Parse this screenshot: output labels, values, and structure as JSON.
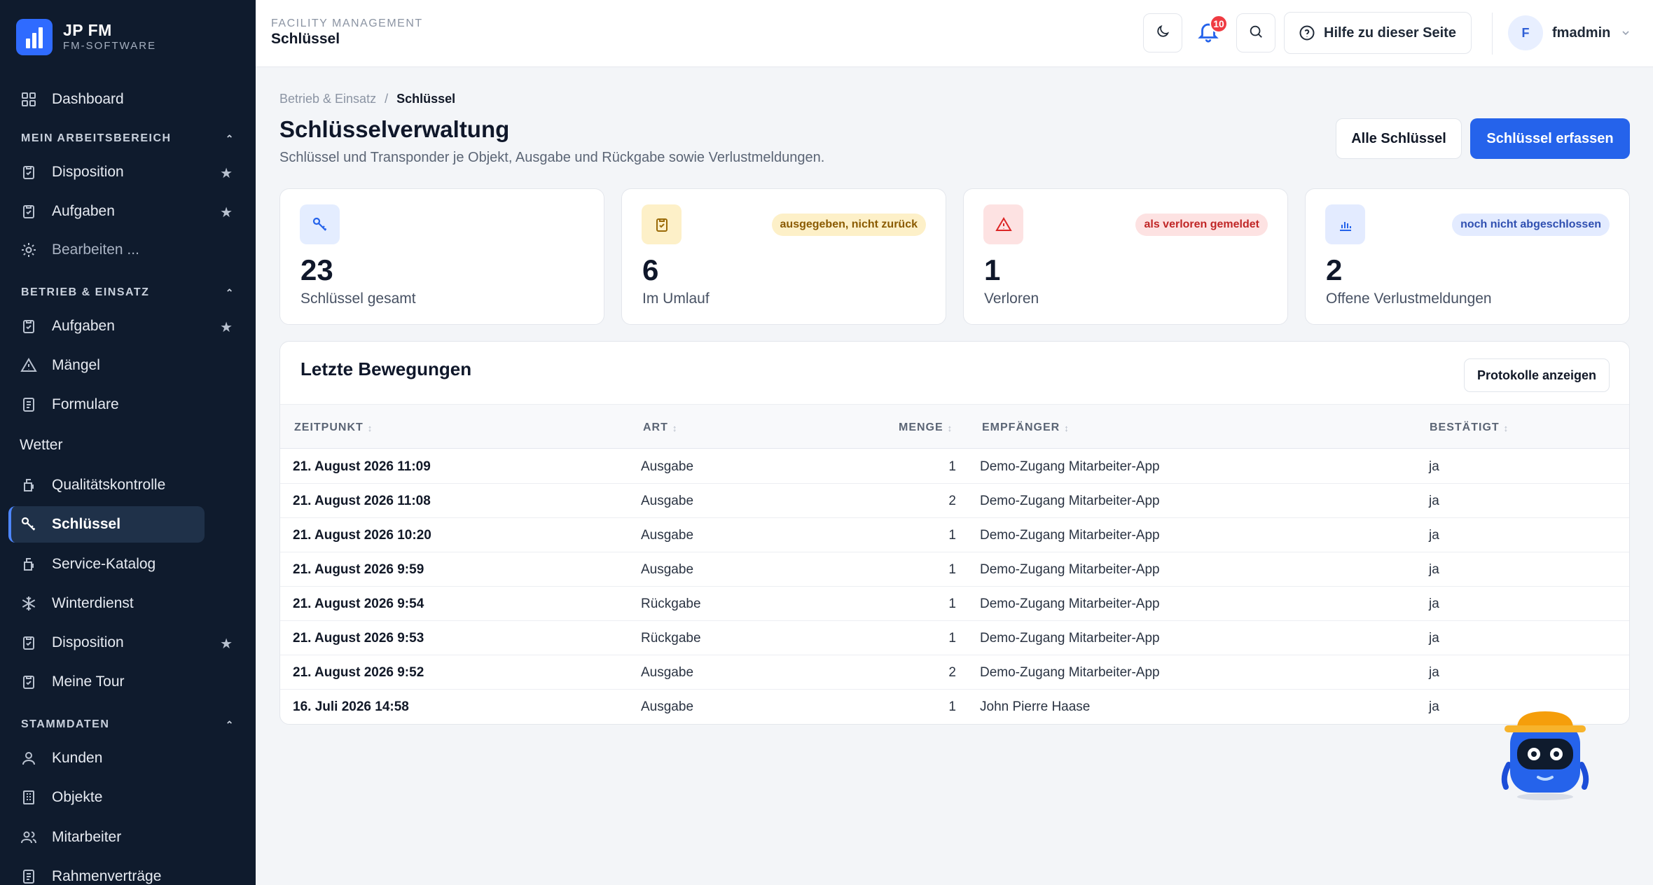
{
  "brand": {
    "title": "JP FM",
    "subtitle": "FM-SOFTWARE"
  },
  "sidebar": {
    "dashboard": "Dashboard",
    "section_work": "MEIN ARBEITSBEREICH",
    "work_items": [
      {
        "label": "Disposition",
        "icon": "clipboard-check-icon",
        "starred": true
      },
      {
        "label": "Aufgaben",
        "icon": "clipboard-check-icon",
        "starred": true
      },
      {
        "label": "Bearbeiten ...",
        "icon": "gear-icon",
        "starred": false
      }
    ],
    "section_ops": "BETRIEB & EINSATZ",
    "ops_items": [
      {
        "label": "Aufgaben",
        "icon": "clipboard-check-icon",
        "starred": true
      },
      {
        "label": "Mängel",
        "icon": "warning-icon",
        "starred": false
      },
      {
        "label": "Formulare",
        "icon": "document-icon",
        "starred": false
      },
      {
        "label": "Wetter"
      },
      {
        "label": "Qualitätskontrolle",
        "icon": "cup-icon",
        "starred": false
      },
      {
        "label": "Schlüssel",
        "icon": "key-icon",
        "starred": false,
        "active": true
      },
      {
        "label": "Service-Katalog",
        "icon": "cup-icon",
        "starred": false
      },
      {
        "label": "Winterdienst",
        "icon": "snowflake-icon",
        "starred": false
      },
      {
        "label": "Disposition",
        "icon": "clipboard-check-icon",
        "starred": true
      },
      {
        "label": "Meine Tour",
        "icon": "clipboard-check-icon",
        "starred": false
      }
    ],
    "section_master": "STAMMDATEN",
    "master_items": [
      {
        "label": "Kunden",
        "icon": "user-icon"
      },
      {
        "label": "Objekte",
        "icon": "building-icon"
      },
      {
        "label": "Mitarbeiter",
        "icon": "users-icon"
      },
      {
        "label": "Rahmenverträge",
        "icon": "document-icon"
      }
    ]
  },
  "topbar": {
    "kicker": "FACILITY MANAGEMENT",
    "title": "Schlüssel",
    "notification_count": "10",
    "help_label": "Hilfe zu dieser Seite",
    "user_initial": "F",
    "user_name": "fmadmin"
  },
  "breadcrumb": {
    "parent": "Betrieb & Einsatz",
    "separator": "/",
    "current": "Schlüssel"
  },
  "page": {
    "title": "Schlüsselverwaltung",
    "subtitle": "Schlüssel und Transponder je Objekt, Ausgabe und Rückgabe sowie Verlustmeldungen.",
    "btn_all": "Alle Schlüssel",
    "btn_create": "Schlüssel erfassen"
  },
  "stats": [
    {
      "value": "23",
      "label": "Schlüssel gesamt",
      "badge": "",
      "icon": "key-icon"
    },
    {
      "value": "6",
      "label": "Im Umlauf",
      "badge": "ausgegeben, nicht zurück",
      "icon": "clipboard-check-icon"
    },
    {
      "value": "1",
      "label": "Verloren",
      "badge": "als verloren gemeldet",
      "icon": "warning-icon"
    },
    {
      "value": "2",
      "label": "Offene Verlustmeldungen",
      "badge": "noch nicht abgeschlossen",
      "icon": "chart-icon"
    }
  ],
  "movements": {
    "title": "Letzte Bewegungen",
    "btn_logs": "Protokolle anzeigen",
    "columns": [
      "ZEITPUNKT",
      "ART",
      "MENGE",
      "EMPFÄNGER",
      "BESTÄTIGT"
    ],
    "rows": [
      {
        "time": "21. August 2026 11:09",
        "art": "Ausgabe",
        "menge": "1",
        "empfaenger": "Demo-Zugang Mitarbeiter-App",
        "bestaetigt": "ja"
      },
      {
        "time": "21. August 2026 11:08",
        "art": "Ausgabe",
        "menge": "2",
        "empfaenger": "Demo-Zugang Mitarbeiter-App",
        "bestaetigt": "ja"
      },
      {
        "time": "21. August 2026 10:20",
        "art": "Ausgabe",
        "menge": "1",
        "empfaenger": "Demo-Zugang Mitarbeiter-App",
        "bestaetigt": "ja"
      },
      {
        "time": "21. August 2026 9:59",
        "art": "Ausgabe",
        "menge": "1",
        "empfaenger": "Demo-Zugang Mitarbeiter-App",
        "bestaetigt": "ja"
      },
      {
        "time": "21. August 2026 9:54",
        "art": "Rückgabe",
        "menge": "1",
        "empfaenger": "Demo-Zugang Mitarbeiter-App",
        "bestaetigt": "ja"
      },
      {
        "time": "21. August 2026 9:53",
        "art": "Rückgabe",
        "menge": "1",
        "empfaenger": "Demo-Zugang Mitarbeiter-App",
        "bestaetigt": "ja"
      },
      {
        "time": "21. August 2026 9:52",
        "art": "Ausgabe",
        "menge": "2",
        "empfaenger": "Demo-Zugang Mitarbeiter-App",
        "bestaetigt": "ja"
      },
      {
        "time": "16. Juli 2026 14:58",
        "art": "Ausgabe",
        "menge": "1",
        "empfaenger": "John Pierre Haase",
        "bestaetigt": "ja"
      }
    ]
  },
  "colors": {
    "sidebar_bg": "#0f1b2d",
    "primary": "#2563eb",
    "badge_amber_bg": "#fdf0c8",
    "badge_red_bg": "#fde2e2",
    "badge_blue_bg": "#e3ebff"
  }
}
